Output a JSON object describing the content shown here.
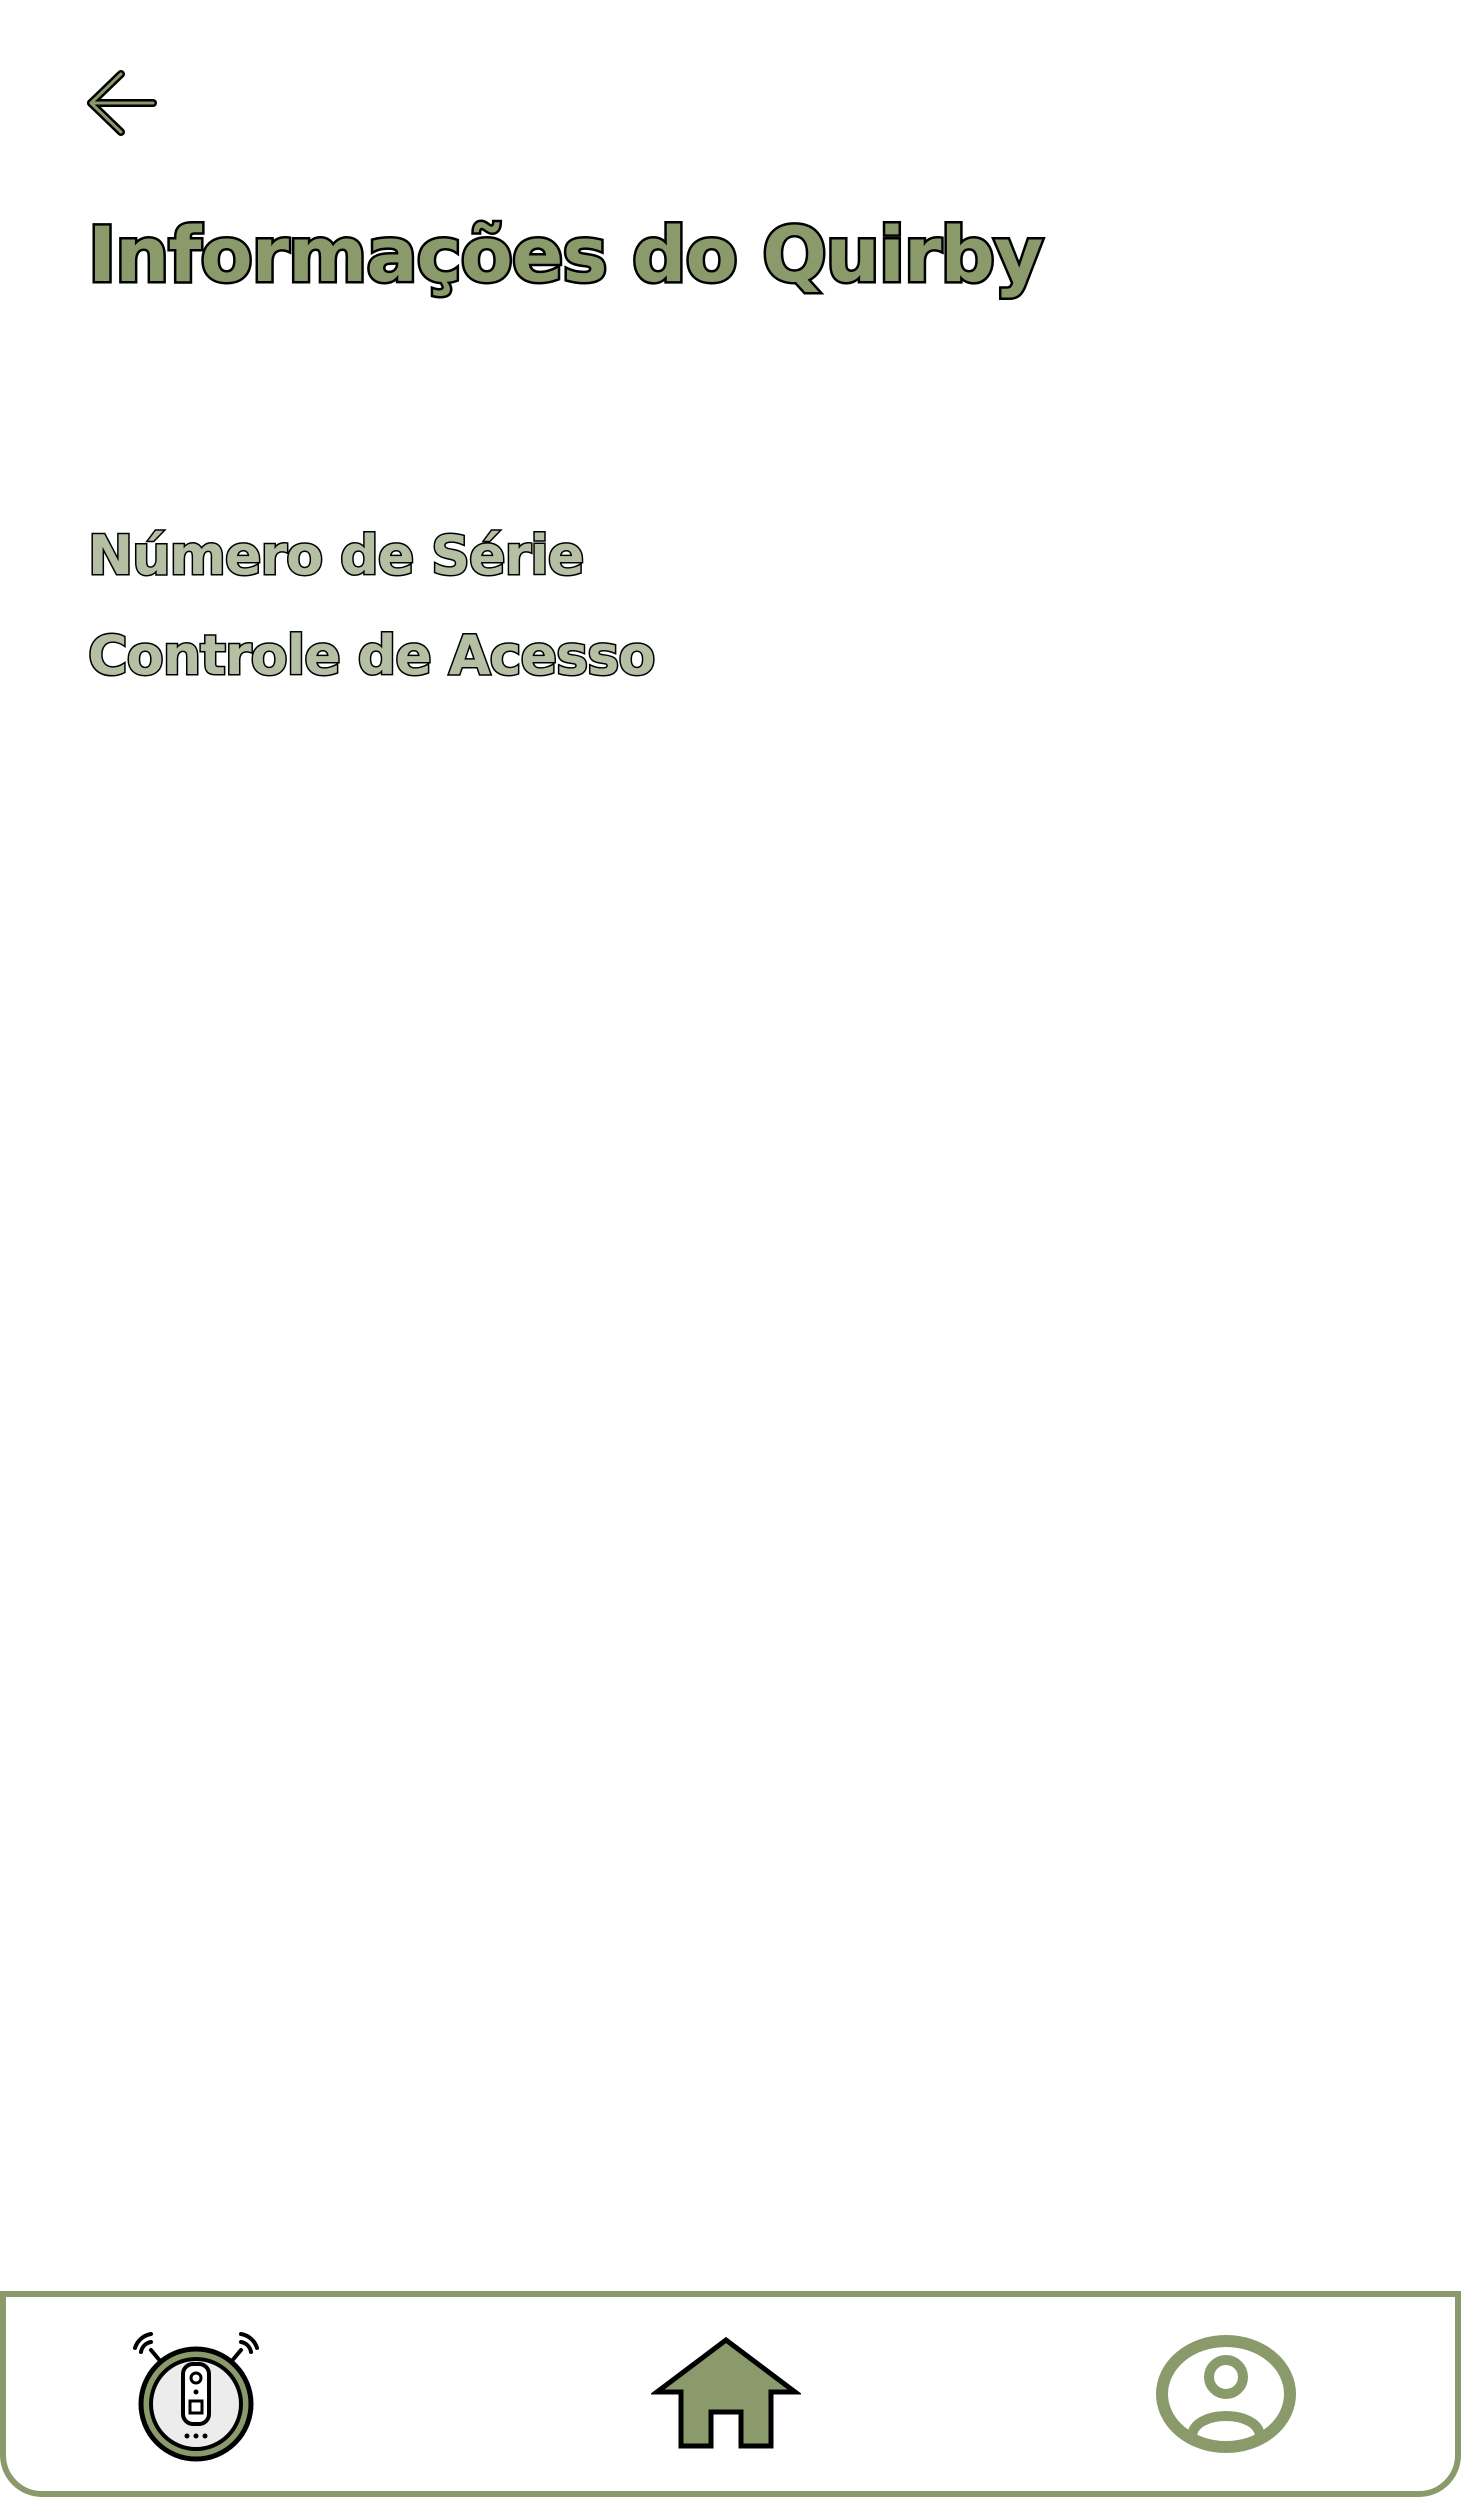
{
  "header": {
    "back_icon": "arrow-left-icon",
    "title": "Informações do Quirby"
  },
  "menu": {
    "items": [
      {
        "label": "Número de Série"
      },
      {
        "label": "Controle de Acesso"
      }
    ]
  },
  "bottom_nav": {
    "items": [
      {
        "icon": "robot-vacuum-icon"
      },
      {
        "icon": "home-icon"
      },
      {
        "icon": "user-profile-icon"
      }
    ]
  },
  "colors": {
    "accent": "#8a9a6b",
    "accent_light": "#b5bfa3",
    "outline": "#000000",
    "background": "#ffffff"
  }
}
